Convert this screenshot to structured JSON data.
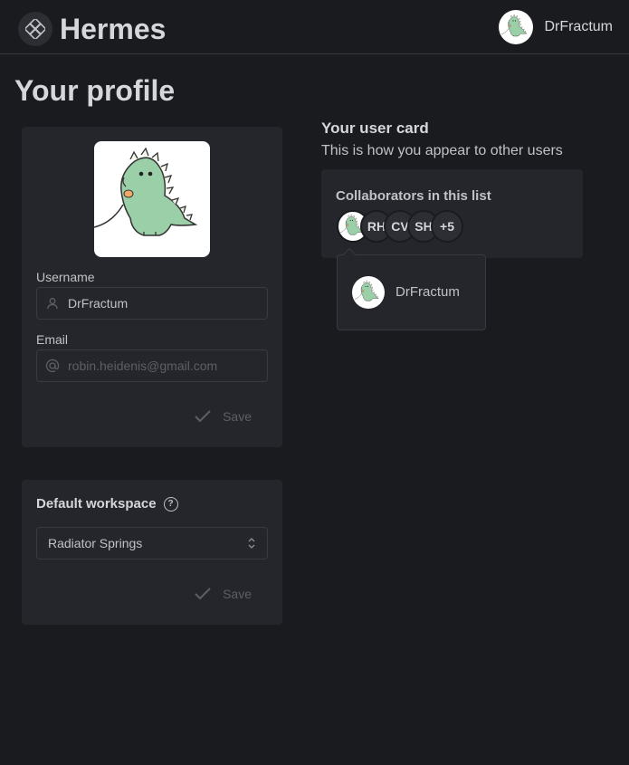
{
  "header": {
    "app_title": "Hermes",
    "logo_icon": "hermes-logo-icon",
    "user": {
      "name": "DrFractum",
      "avatar": "dinosaur-avatar"
    }
  },
  "page": {
    "title": "Your profile"
  },
  "profile_card": {
    "username_label": "Username",
    "username_value": "DrFractum",
    "email_label": "Email",
    "email_placeholder": "robin.heidenis@gmail.com",
    "save_label": "Save"
  },
  "workspace_card": {
    "title": "Default workspace",
    "selected": "Radiator Springs",
    "save_label": "Save"
  },
  "user_card": {
    "title": "Your user card",
    "subtitle": "This is how you appear to other users",
    "collab_title": "Collaborators in this list",
    "collaborators": [
      "RH",
      "CV",
      "SH"
    ],
    "more": "+5",
    "popover_name": "DrFractum"
  },
  "colors": {
    "background": "#1a1b1e",
    "card": "#25262b",
    "border": "#373a40",
    "dino_green": "#9bcfa8"
  }
}
